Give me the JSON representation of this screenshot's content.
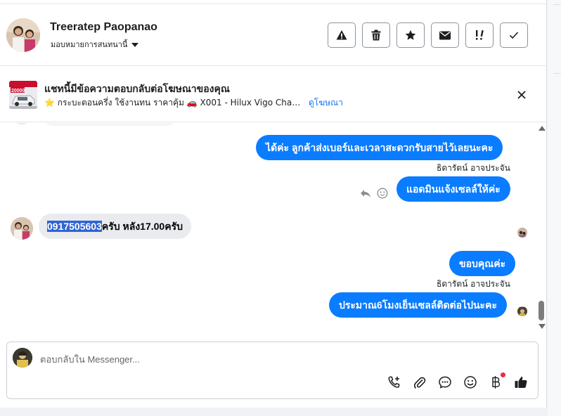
{
  "header": {
    "contact_name": "Treeratep Paopanao",
    "assign_label": "มอบหมายการสนทนานี้",
    "actions": [
      {
        "icon": "warning-icon"
      },
      {
        "icon": "trash-icon"
      },
      {
        "icon": "star-icon"
      },
      {
        "icon": "envelope-icon"
      },
      {
        "icon": "follow-up-icon"
      },
      {
        "icon": "check-icon"
      }
    ]
  },
  "ad_banner": {
    "title": "แชทนี้มีข้อความตอบกลับต่อโฆษณาของคุณ",
    "subtitle": "⭐ กระบะตอนครึ่ง ใช้งานทน ราคาคุ้ม 🚗 X001 - Hilux Vigo Champ Ca...",
    "link_label": "ดูโฆษณา",
    "thumb_price": "20000"
  },
  "messages": [
    {
      "direction": "out",
      "text": "ได้ค่ะ ลูกค้าส่งเบอร์และเวลาสะดวกรับสายไว้เลยนะคะ",
      "sender": "ธิดารัตน์ อาจประจัน"
    },
    {
      "direction": "out",
      "text": "แอดมินแจ้งเซลล์ให้ค่ะ"
    },
    {
      "direction": "in",
      "highlight": "0917505603",
      "text": "ครับ หลัง17.00ครับ"
    },
    {
      "direction": "out",
      "text": "ขอบคุณค่ะ",
      "sender": "ธิดารัตน์ อาจประจัน"
    },
    {
      "direction": "out",
      "text": "ประมาณ6โมงเย็นเซลล์ติดต่อไปนะคะ"
    }
  ],
  "composer": {
    "placeholder": "ตอบกลับใน Messenger...",
    "tools": [
      "call-add-icon",
      "attachment-icon",
      "saved-reply-icon",
      "emoji-icon",
      "baht-payment-icon",
      "thumbs-up-icon"
    ]
  },
  "colors": {
    "accent": "#0a7cff",
    "link": "#1877f2",
    "incoming_bubble": "#e9ebee",
    "highlight": "#2e64d6",
    "notification_dot": "#f02849"
  }
}
